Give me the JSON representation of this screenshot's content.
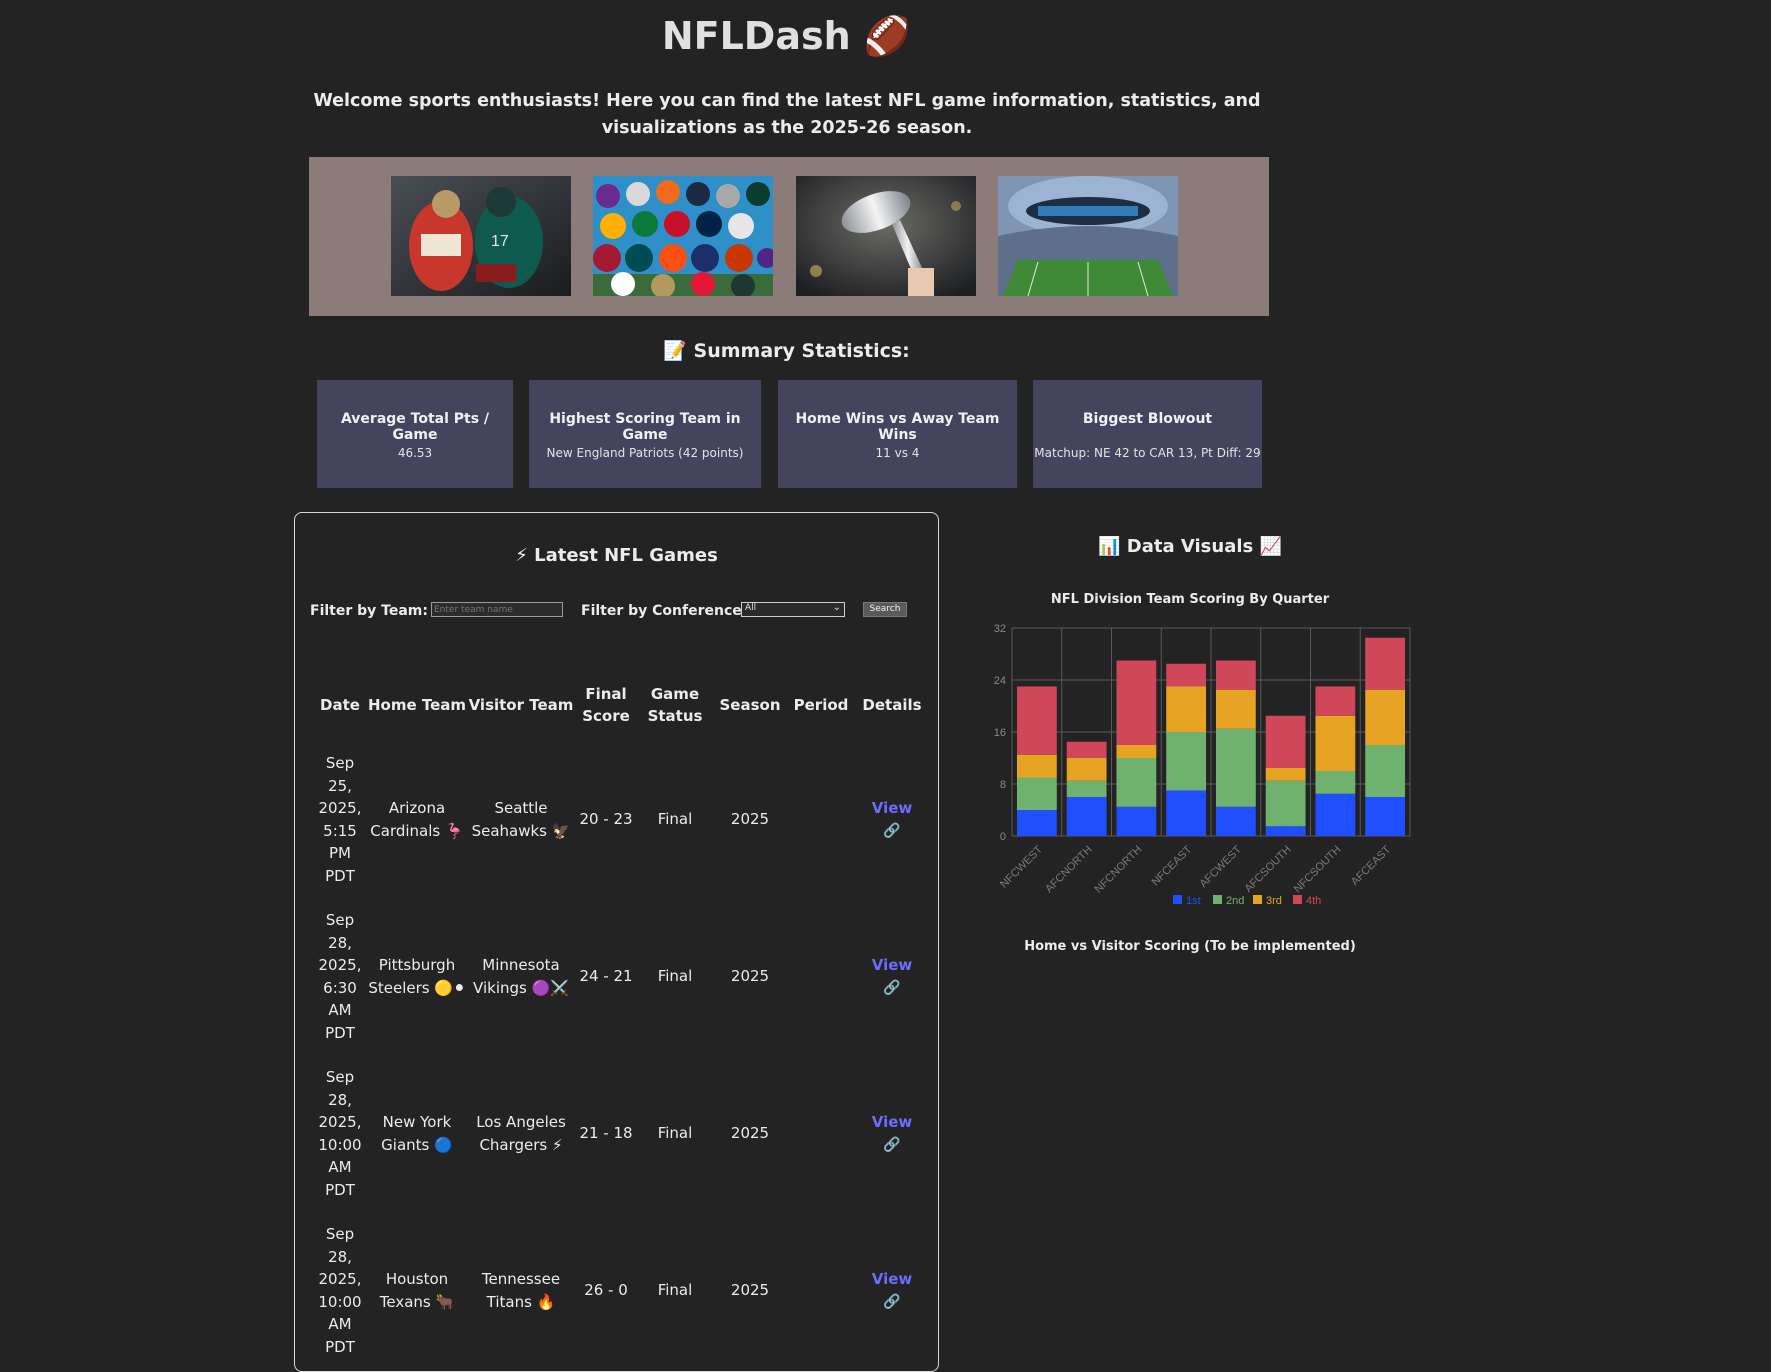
{
  "header": {
    "title": "NFLDash 🏈",
    "subtitle": "Welcome sports enthusiasts! Here you can find the latest NFL game information, statistics, and visualizations as the 2025-26 season."
  },
  "summary": {
    "heading": "📝 Summary Statistics:",
    "cards": [
      {
        "label": "Average Total Pts / Game",
        "value": "46.53"
      },
      {
        "label": "Highest Scoring Team in Game",
        "value": "New England Patriots (42 points)"
      },
      {
        "label": "Home Wins vs Away Team Wins",
        "value": "11 vs 4"
      },
      {
        "label": "Biggest Blowout",
        "value": "Matchup: NE 42 to CAR 13, Pt Diff: 29"
      }
    ]
  },
  "games": {
    "heading": "⚡ Latest NFL Games",
    "filter_team_label": "Filter by Team:",
    "filter_team_placeholder": "Enter team name",
    "filter_conf_label": "Filter by Conference:",
    "filter_conf_value": "All",
    "search_label": "Search",
    "columns": [
      "Date",
      "Home Team",
      "Visitor Team",
      "Final Score",
      "Game Status",
      "Season",
      "Period",
      "Details"
    ],
    "rows": [
      {
        "date": "Sep 25, 2025, 5:15 PM PDT",
        "home": "Arizona Cardinals 🦩",
        "visitor": "Seattle Seahawks 🦅",
        "score": "20 - 23",
        "status": "Final",
        "season": "2025",
        "period": "",
        "details": "View"
      },
      {
        "date": "Sep 28, 2025, 6:30 AM PDT",
        "home": "Pittsburgh Steelers 🟡⚫",
        "visitor": "Minnesota Vikings 🟣⚔️",
        "score": "24 - 21",
        "status": "Final",
        "season": "2025",
        "period": "",
        "details": "View"
      },
      {
        "date": "Sep 28, 2025, 10:00 AM PDT",
        "home": "New York Giants 🔵",
        "visitor": "Los Angeles Chargers ⚡",
        "score": "21 - 18",
        "status": "Final",
        "season": "2025",
        "period": "",
        "details": "View"
      },
      {
        "date": "Sep 28, 2025, 10:00 AM PDT",
        "home": "Houston Texans 🐂",
        "visitor": "Tennessee Titans 🔥",
        "score": "26 - 0",
        "status": "Final",
        "season": "2025",
        "period": "",
        "details": "View"
      }
    ]
  },
  "visuals": {
    "heading": "📊 Data Visuals 📈",
    "second_chart_title": "Home vs Visitor Scoring (To be implemented)"
  },
  "chart_data": {
    "type": "bar",
    "stacked": true,
    "title": "NFL Division Team Scoring By Quarter",
    "categories": [
      "NFCWEST",
      "AFCNORTH",
      "NFCNORTH",
      "NFCEAST",
      "AFCWEST",
      "AFCSOUTH",
      "NFCSOUTH",
      "AFCEAST"
    ],
    "series": [
      {
        "name": "1st",
        "color": "#1f4fff",
        "values": [
          4,
          6,
          4.5,
          7,
          4.5,
          1.5,
          6.5,
          6
        ]
      },
      {
        "name": "2nd",
        "color": "#6fb26f",
        "values": [
          5,
          2.5,
          7.5,
          9,
          12,
          7,
          3.5,
          8
        ]
      },
      {
        "name": "3rd",
        "color": "#e6a422",
        "values": [
          3.5,
          3.5,
          2,
          7,
          6,
          2,
          8.5,
          8.5
        ]
      },
      {
        "name": "4th",
        "color": "#d1475a",
        "values": [
          10.5,
          2.5,
          13,
          3.5,
          4.5,
          8,
          4.5,
          8
        ]
      }
    ],
    "ylim": [
      0,
      32
    ],
    "yticks": [
      0,
      8,
      16,
      24,
      32
    ],
    "grid": true,
    "legend": "bottom"
  }
}
